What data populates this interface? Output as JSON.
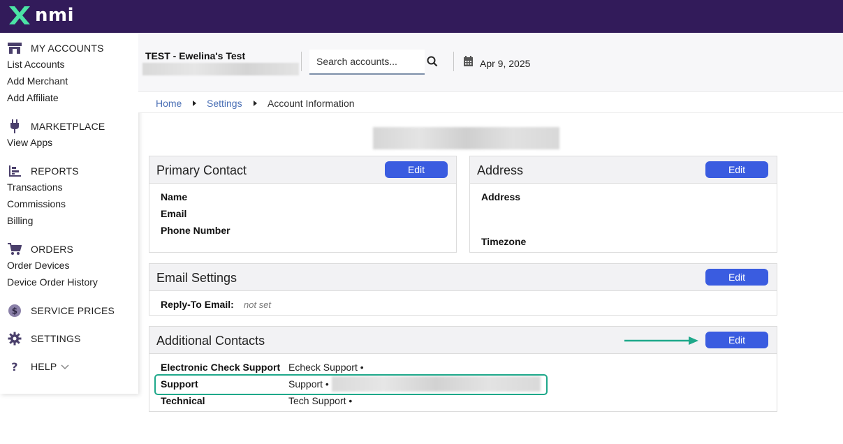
{
  "brand": {
    "logo_text": "nmi"
  },
  "sidebar": {
    "sections": [
      {
        "label": "MY ACCOUNTS",
        "icon": "store-icon",
        "items": [
          "List Accounts",
          "Add Merchant",
          "Add Affiliate"
        ]
      },
      {
        "label": "MARKETPLACE",
        "icon": "plug-icon",
        "items": [
          "View Apps"
        ]
      },
      {
        "label": "REPORTS",
        "icon": "chart-icon",
        "items": [
          "Transactions",
          "Commissions",
          "Billing"
        ]
      },
      {
        "label": "ORDERS",
        "icon": "cart-icon",
        "items": [
          "Order Devices",
          "Device Order History"
        ]
      },
      {
        "label": "SERVICE PRICES",
        "icon": "dollar-icon",
        "items": []
      },
      {
        "label": "SETTINGS",
        "icon": "gear-icon",
        "items": []
      },
      {
        "label": "HELP",
        "icon": "question-icon",
        "items": []
      }
    ]
  },
  "header": {
    "account_name": "TEST - Ewelina's Test",
    "search_placeholder": "Search accounts...",
    "date": "Apr 9, 2025"
  },
  "breadcrumb": {
    "home": "Home",
    "settings": "Settings",
    "current": "Account Information"
  },
  "primary_contact": {
    "title": "Primary Contact",
    "edit_label": "Edit",
    "fields": [
      "Name",
      "Email",
      "Phone Number"
    ]
  },
  "address": {
    "title": "Address",
    "edit_label": "Edit",
    "address_label": "Address",
    "timezone_label": "Timezone"
  },
  "email_settings": {
    "title": "Email Settings",
    "edit_label": "Edit",
    "reply_to_label": "Reply-To Email:",
    "reply_to_value": "not set"
  },
  "additional_contacts": {
    "title": "Additional Contacts",
    "edit_label": "Edit",
    "rows": [
      {
        "label": "Electronic Check Support",
        "value": "Echeck Support •"
      },
      {
        "label": "Support",
        "value": "Support •"
      },
      {
        "label": "Technical",
        "value": "Tech Support •"
      }
    ]
  },
  "colors": {
    "topbar": "#321b5a",
    "button": "#3a5ce0",
    "highlight": "#1ea88a",
    "link": "#4a6fb5"
  }
}
